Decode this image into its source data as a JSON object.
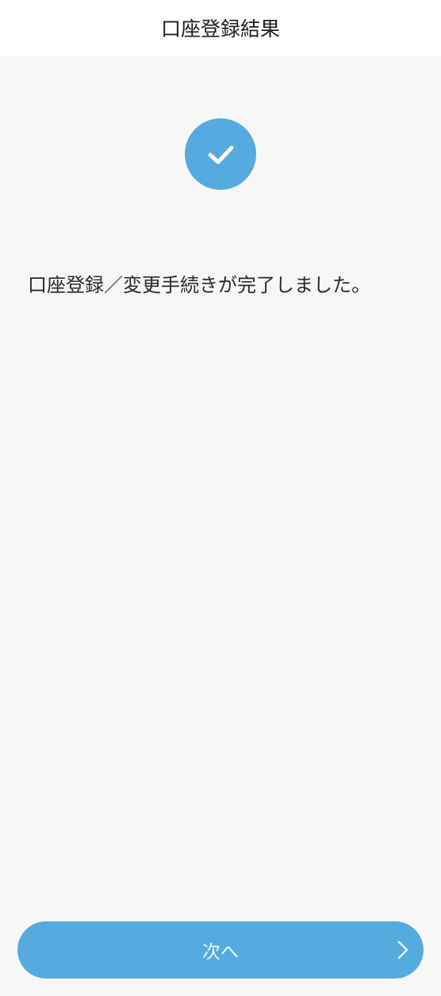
{
  "header": {
    "title": "口座登録結果"
  },
  "status": {
    "icon": "check-icon",
    "message": "口座登録／変更手続きが完了しました。"
  },
  "footer": {
    "next_label": "次へ",
    "next_icon": "chevron-right-icon"
  },
  "colors": {
    "accent": "#55abe0",
    "background": "#f7f7f7",
    "header_background": "#ffffff"
  }
}
